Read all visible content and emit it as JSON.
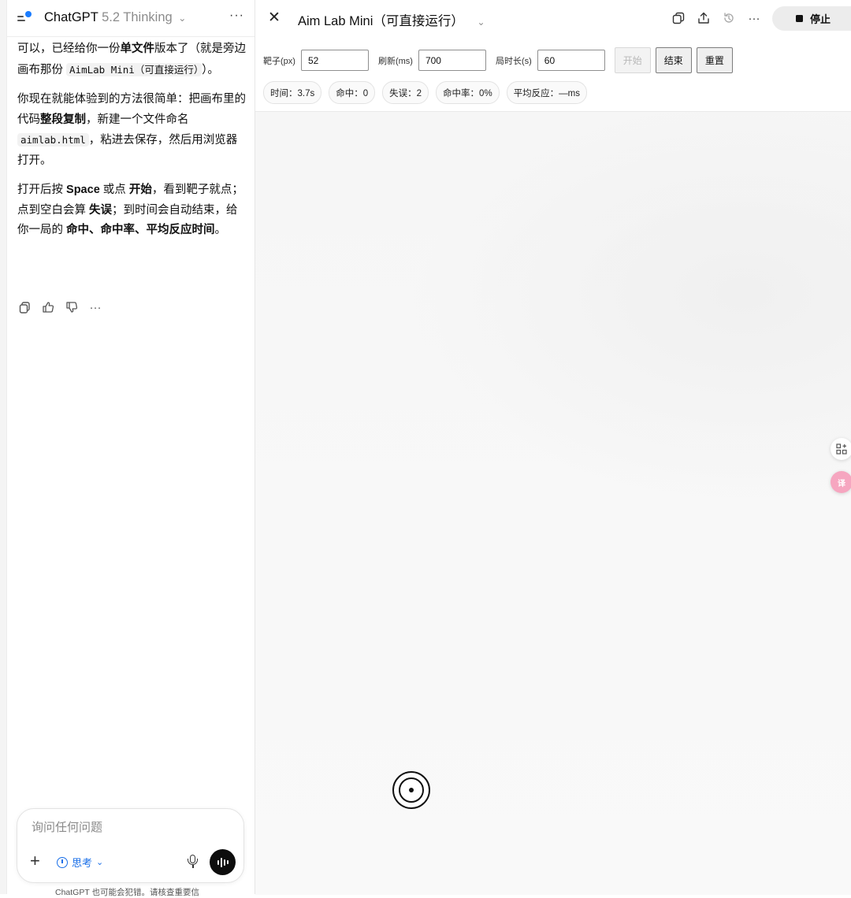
{
  "chat": {
    "model_brand": "ChatGPT",
    "model_variant": "5.2 Thinking",
    "message": {
      "p1_a": "可以，已经给你一份",
      "p1_b": "单文件",
      "p1_c": "版本了（就是旁边画布那份 ",
      "p1_code": "AimLab Mini（可直接运行）",
      "p1_d": "）。",
      "p2_a": "你现在就能体验到的方法很简单：把画布里的代码",
      "p2_b": "整段复制",
      "p2_c": "，新建一个文件命名 ",
      "p2_code": "aimlab.html",
      "p2_d": "，粘进去保存，然后用浏览器打开。",
      "p3_a": "打开后按 ",
      "p3_b": "Space",
      "p3_c": " 或点 ",
      "p3_d": "开始",
      "p3_e": "，看到靶子就点；点到空白会算 ",
      "p3_f": "失误",
      "p3_g": "；到时间会自动结束，给你一局的 ",
      "p3_h": "命中、命中率、平均反应时间",
      "p3_i": "。"
    },
    "composer_placeholder": "询问任何问题",
    "think_label": "思考",
    "disclaimer": "ChatGPT 也可能会犯错。请核查重要信"
  },
  "canvas": {
    "title": "Aim Lab Mini（可直接运行）",
    "stop_label": "停止",
    "controls": {
      "target_label": "靶子(px)",
      "target_value": "52",
      "refresh_label": "刷新(ms)",
      "refresh_value": "700",
      "duration_label": "局时长(s)",
      "duration_value": "60",
      "start_label": "开始",
      "end_label": "结束",
      "reset_label": "重置"
    },
    "stats": {
      "time": "时间：3.7s",
      "hits": "命中：0",
      "misses": "失误：2",
      "hit_rate": "命中率：0%",
      "avg_reaction": "平均反应：—ms"
    }
  },
  "colors": {
    "accent_blue": "#1a6fe8",
    "stop_bg": "#ececec",
    "translate_badge": "#f6a6c0"
  },
  "icons": [
    "sidebar-toggle-icon",
    "chevron-down-icon",
    "more-icon",
    "copy-icon",
    "thumbs-up-icon",
    "thumbs-down-icon",
    "close-icon",
    "share-icon",
    "history-icon",
    "stop-icon",
    "plus-icon",
    "timer-icon",
    "microphone-icon",
    "voice-mode-icon",
    "apps-icon",
    "translate-icon",
    "target-icon"
  ]
}
